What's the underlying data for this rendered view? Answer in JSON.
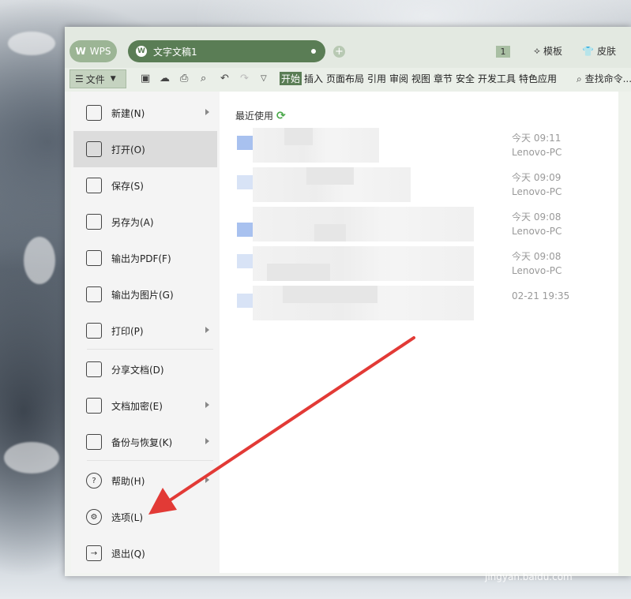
{
  "tabs": {
    "app": "WPS",
    "document": "文字文稿1",
    "count": "1"
  },
  "top_right": {
    "template": "模板",
    "skin": "皮肤"
  },
  "toolbar": {
    "file": "文件",
    "search": "查找命令..."
  },
  "ribbon": [
    "开始",
    "插入",
    "页面布局",
    "引用",
    "审阅",
    "视图",
    "章节",
    "安全",
    "开发工具",
    "特色应用"
  ],
  "menu": [
    {
      "label": "新建(N)",
      "icon": "new-doc-icon",
      "arrow": true
    },
    {
      "label": "打开(O)",
      "icon": "folder-open-icon",
      "arrow": false
    },
    {
      "label": "保存(S)",
      "icon": "save-icon",
      "arrow": false
    },
    {
      "label": "另存为(A)",
      "icon": "save-as-icon",
      "arrow": false
    },
    {
      "label": "输出为PDF(F)",
      "icon": "pdf-export-icon",
      "arrow": false
    },
    {
      "label": "输出为图片(G)",
      "icon": "image-export-icon",
      "arrow": false
    },
    {
      "label": "打印(P)",
      "icon": "print-icon",
      "arrow": true
    },
    {
      "label": "分享文档(D)",
      "icon": "share-icon",
      "arrow": false
    },
    {
      "label": "文档加密(E)",
      "icon": "encrypt-icon",
      "arrow": true
    },
    {
      "label": "备份与恢复(K)",
      "icon": "backup-icon",
      "arrow": true
    },
    {
      "label": "帮助(H)",
      "icon": "help-icon",
      "arrow": true
    },
    {
      "label": "选项(L)",
      "icon": "gear-icon",
      "arrow": false
    },
    {
      "label": "退出(Q)",
      "icon": "exit-icon",
      "arrow": false
    }
  ],
  "recent": {
    "title": "最近使用",
    "items": [
      {
        "time": "今天 09:11",
        "device": "Lenovo-PC"
      },
      {
        "time": "今天 09:09",
        "device": "Lenovo-PC"
      },
      {
        "time": "今天 09:08",
        "device": "Lenovo-PC"
      },
      {
        "time": "今天 09:08",
        "device": "Lenovo-PC"
      },
      {
        "time": "02-21 19:35",
        "device": ""
      }
    ]
  },
  "watermark": {
    "brand": "Baidu经验",
    "url": "jingyan.baidu.com"
  },
  "colors": {
    "accent": "#5a7d55",
    "arrow": "#e23a36"
  }
}
